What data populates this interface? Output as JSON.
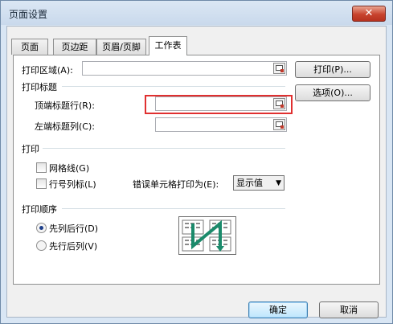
{
  "window": {
    "title": "页面设置",
    "close_glyph": "✕"
  },
  "tabs": [
    {
      "label": "页面",
      "active": false
    },
    {
      "label": "页边距",
      "active": false
    },
    {
      "label": "页眉/页脚",
      "active": false
    },
    {
      "label": "工作表",
      "active": true
    }
  ],
  "sheet": {
    "print_area_label": "打印区域(A):",
    "print_area_value": "",
    "print_titles_section": "打印标题",
    "top_rows_label": "顶端标题行(R):",
    "top_rows_value": "",
    "left_cols_label": "左端标题列(C):",
    "left_cols_value": "",
    "print_section": "打印",
    "gridlines_label": "网格线(G)",
    "gridlines_checked": false,
    "row_col_headers_label": "行号列标(L)",
    "row_col_headers_checked": false,
    "errors_label": "错误单元格打印为(E):",
    "errors_value": "显示值",
    "page_order_section": "打印顺序",
    "down_then_over_label": "先列后行(D)",
    "down_then_over_checked": true,
    "over_then_down_label": "先行后列(V)",
    "over_then_down_checked": false
  },
  "side_buttons": {
    "print": "打印(P)...",
    "options": "选项(O)..."
  },
  "footer": {
    "ok": "确定",
    "cancel": "取消"
  },
  "colors": {
    "highlight": "#e03030",
    "accent": "#3c7fb1"
  }
}
